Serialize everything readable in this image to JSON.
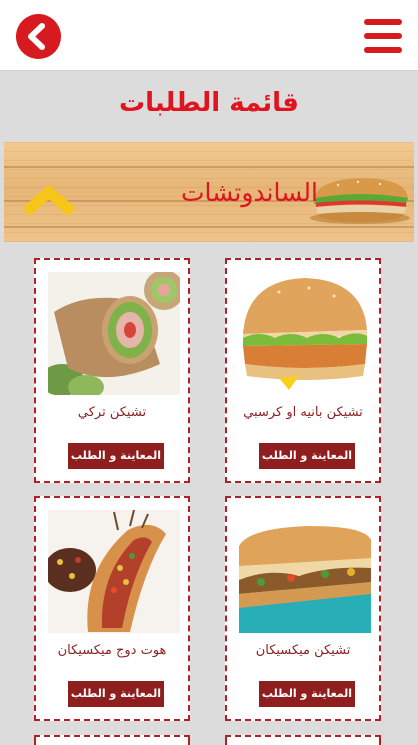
{
  "header": {
    "back_icon": "chevron-left-icon",
    "menu_icon": "hamburger-menu-icon",
    "accent_color": "#d71920"
  },
  "page": {
    "title": "قائمة الطلبات"
  },
  "category": {
    "label": "الساندوتشات",
    "toggle_icon": "chevron-up-icon",
    "toggle_color": "#f5c518"
  },
  "products": [
    {
      "name": "تشيكن بانيه او كرسبي",
      "button": "المعاينة و الطلب"
    },
    {
      "name": "تشيكن تركي",
      "button": "المعاينة و الطلب"
    },
    {
      "name": "تشيكن ميكسيكان",
      "button": "المعاينة و الطلب"
    },
    {
      "name": "هوت دوج ميكسيكان",
      "button": "المعاينة و الطلب"
    }
  ]
}
